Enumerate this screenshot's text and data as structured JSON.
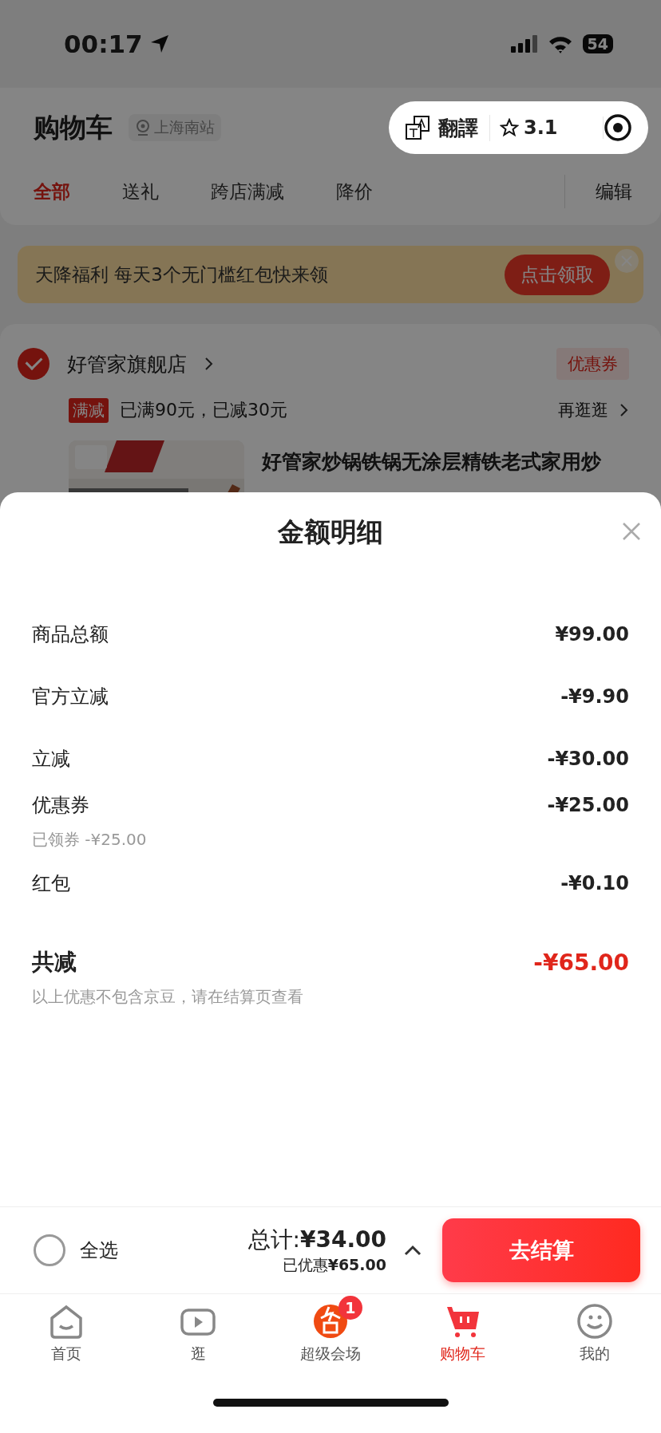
{
  "status_bar": {
    "time": "00:17",
    "battery": "54"
  },
  "header": {
    "title": "购物车",
    "location": "上海南站"
  },
  "capsule": {
    "translate": "翻譯",
    "rating": "3.1"
  },
  "tabs": [
    {
      "label": "全部",
      "selected": true
    },
    {
      "label": "送礼",
      "selected": false
    },
    {
      "label": "跨店满减",
      "selected": false
    },
    {
      "label": "降价",
      "selected": false
    }
  ],
  "edit": "编辑",
  "banner": {
    "text": "天降福利 每天3个无门槛红包快来领",
    "button": "点击领取"
  },
  "store": {
    "checked": true,
    "name": "好管家旗舰店",
    "coupon": "优惠券",
    "promo_tag": "满减",
    "promo_text": "已满90元，已减30元",
    "more": "再逛逛",
    "product_title": "好管家炒锅铁锅无涂层精铁老式家用炒"
  },
  "sheet": {
    "title": "金额明细",
    "rows": [
      {
        "label": "商品总额",
        "value": "¥99.00"
      },
      {
        "label": "官方立减",
        "value": "-¥9.90"
      },
      {
        "label": "立减",
        "value": "-¥30.00"
      },
      {
        "label": "优惠券",
        "value": "-¥25.00",
        "note": "已领券 -¥25.00"
      },
      {
        "label": "红包",
        "value": "-¥0.10"
      }
    ],
    "total": {
      "label": "共减",
      "value": "-¥65.00"
    },
    "footnote": "以上优惠不包含京豆，请在结算页查看"
  },
  "checkout": {
    "select_all": {
      "label": "全选",
      "checked": false
    },
    "total": "总计:**¥34.00**",
    "saved": "已优惠**¥65.00**",
    "button": "去结算"
  },
  "nav": [
    {
      "label": "首页",
      "selected": false
    },
    {
      "label": "逛",
      "selected": false
    },
    {
      "label": "超级会场",
      "selected": false,
      "badge": "1"
    },
    {
      "label": "购物车",
      "selected": true
    },
    {
      "label": "我的",
      "selected": false
    }
  ]
}
